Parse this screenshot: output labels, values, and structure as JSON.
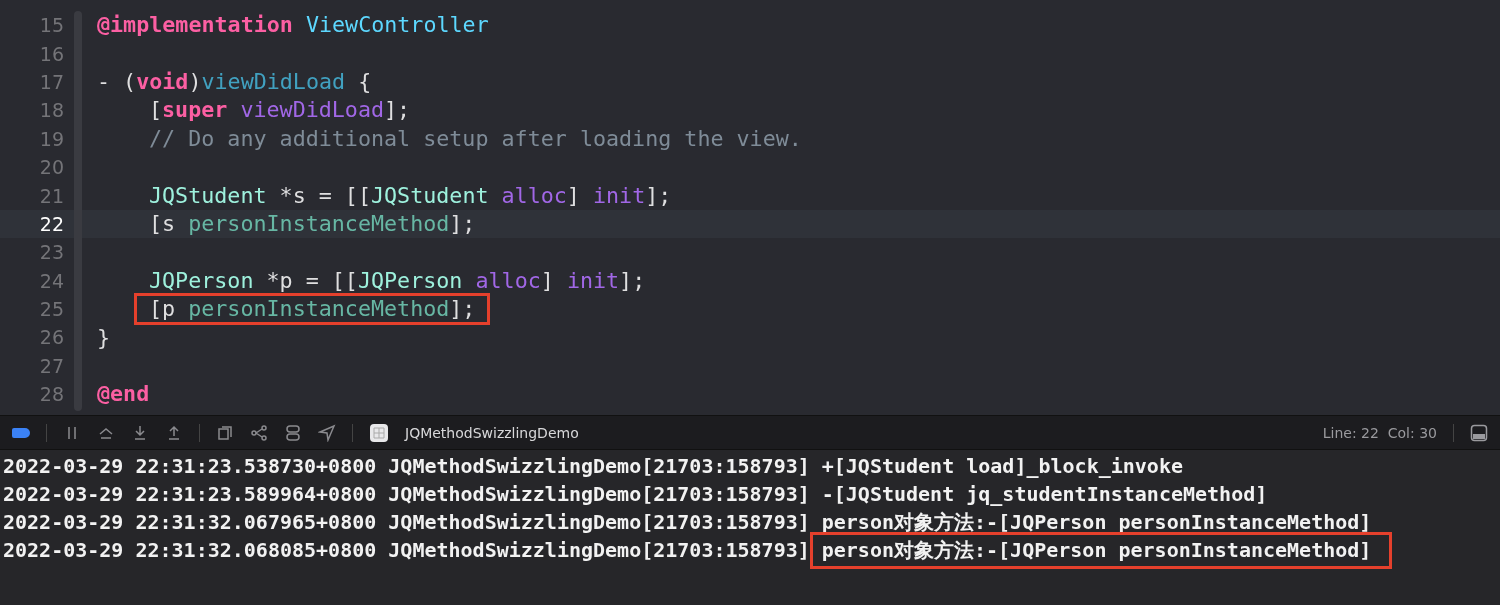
{
  "editor": {
    "lines": [
      {
        "number": "15",
        "current": false,
        "highlighted": false,
        "tokens": [
          {
            "kind": "keyword",
            "text": "@implementation"
          },
          {
            "kind": "type",
            "text": " ViewController"
          }
        ]
      },
      {
        "number": "16",
        "current": false
      },
      {
        "number": "17",
        "current": false,
        "highlighted": false,
        "tokens": [
          {
            "kind": "plain",
            "text": "- ("
          },
          {
            "kind": "keyword",
            "text": "void"
          },
          {
            "kind": "plain",
            "text": ")"
          },
          {
            "kind": "declaration",
            "text": "viewDidLoad"
          },
          {
            "kind": "plain",
            "text": " {"
          }
        ]
      },
      {
        "number": "18",
        "current": false,
        "highlighted": false,
        "indented": true,
        "tokens": [
          {
            "kind": "plain",
            "text": "["
          },
          {
            "kind": "keyword",
            "text": "super"
          },
          {
            "kind": "call",
            "text": " viewDidLoad"
          },
          {
            "kind": "plain",
            "text": "];"
          }
        ]
      },
      {
        "number": "19",
        "current": false,
        "highlighted": false,
        "indented": true,
        "tokens": [
          {
            "kind": "comment",
            "text": "// Do any additional setup after loading the view."
          }
        ]
      },
      {
        "number": "20",
        "current": false
      },
      {
        "number": "21",
        "current": false,
        "highlighted": false,
        "indented": true,
        "tokens": [
          {
            "kind": "class",
            "text": "JQStudent"
          },
          {
            "kind": "plain",
            "text": " *s = [["
          },
          {
            "kind": "class",
            "text": "JQStudent"
          },
          {
            "kind": "call",
            "text": " alloc"
          },
          {
            "kind": "plain",
            "text": "] "
          },
          {
            "kind": "call",
            "text": "init"
          },
          {
            "kind": "plain",
            "text": "];"
          }
        ]
      },
      {
        "number": "22",
        "current": true,
        "highlighted": false,
        "indented": true,
        "tokens": [
          {
            "kind": "plain",
            "text": "[s "
          },
          {
            "kind": "project",
            "text": "personInstanceMethod"
          },
          {
            "kind": "plain",
            "text": "];"
          }
        ]
      },
      {
        "number": "23",
        "current": false
      },
      {
        "number": "24",
        "current": false,
        "highlighted": false,
        "indented": true,
        "tokens": [
          {
            "kind": "class",
            "text": "JQPerson"
          },
          {
            "kind": "plain",
            "text": " *p = [["
          },
          {
            "kind": "class",
            "text": "JQPerson"
          },
          {
            "kind": "call",
            "text": " alloc"
          },
          {
            "kind": "plain",
            "text": "] "
          },
          {
            "kind": "call",
            "text": "init"
          },
          {
            "kind": "plain",
            "text": "];"
          }
        ]
      },
      {
        "number": "25",
        "current": false,
        "highlighted": true,
        "indented": true,
        "tokens": [
          {
            "kind": "plain",
            "text": "[p "
          },
          {
            "kind": "project",
            "text": "personInstanceMethod"
          },
          {
            "kind": "plain",
            "text": "];"
          }
        ]
      },
      {
        "number": "26",
        "current": false,
        "highlighted": false,
        "tokens": [
          {
            "kind": "plain",
            "text": "}"
          }
        ]
      },
      {
        "number": "27",
        "current": false
      },
      {
        "number": "28",
        "current": false,
        "highlighted": false,
        "tokens": [
          {
            "kind": "keyword",
            "text": "@end"
          }
        ]
      }
    ]
  },
  "debug_bar": {
    "breakpoints_on": true,
    "target": "JQMethodSwizzlingDemo",
    "position": "Line: 22  Col: 30"
  },
  "console": {
    "lines": [
      {
        "prefix": "2022-03-29 22:31:23.538730+0800 JQMethodSwizzlingDemo[21703:158793]",
        "message": "+[JQStudent load]_block_invoke",
        "highlighted": false
      },
      {
        "prefix": "2022-03-29 22:31:23.589964+0800 JQMethodSwizzlingDemo[21703:158793]",
        "message": "-[JQStudent jq_studentInstanceMethod]",
        "highlighted": false
      },
      {
        "prefix": "2022-03-29 22:31:32.067965+0800 JQMethodSwizzlingDemo[21703:158793]",
        "message": "person对象方法:-[JQPerson personInstanceMethod]",
        "highlighted": false
      },
      {
        "prefix": "2022-03-29 22:31:32.068085+0800 JQMethodSwizzlingDemo[21703:158793]",
        "message": "person对象方法:-[JQPerson personInstanceMethod]",
        "highlighted": true
      }
    ]
  }
}
